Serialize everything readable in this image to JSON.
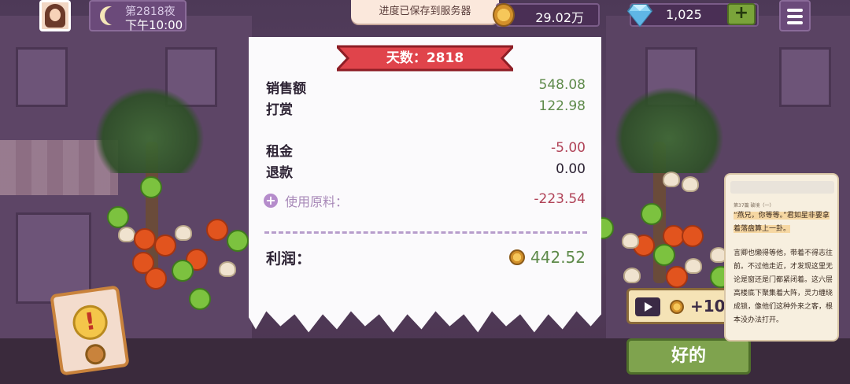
{
  "topbar": {
    "night_label": "第2818夜",
    "time_label": "下午10:00",
    "toast": "进度已保存到服务器",
    "coins": "29.02万",
    "gems": "1,025",
    "add_label": "+"
  },
  "receipt": {
    "day_banner": "天数：2818",
    "rows": [
      {
        "label": "销售额",
        "value": "548.08"
      },
      {
        "label": "打赏",
        "value": "122.98"
      },
      {
        "label": "租金",
        "value": "-5.00"
      },
      {
        "label": "退款",
        "value": "0.00"
      }
    ],
    "materials": {
      "icon": "+",
      "label": "使用原料：",
      "value": "-223.54"
    },
    "profit": {
      "label": "利润：",
      "value": "442.52"
    }
  },
  "actions": {
    "ad_reward": "+10",
    "ok_label": "好的"
  },
  "book": {
    "crumb": "第37篇 破境（一）",
    "paragraphs": [
      "“燕兄，你等等。”君如星非要拿着落盘算上一卦。",
      "言卿也懒得等他，带着不得志往前。不过他走近，才发现这里无论是窗还是门都紧闭着。这六层高楼底下聚集着大阵，灵力缠绕成锁，像他们这种外来之客，根本没办法打开。"
    ]
  },
  "warning": {
    "icon": "!"
  }
}
